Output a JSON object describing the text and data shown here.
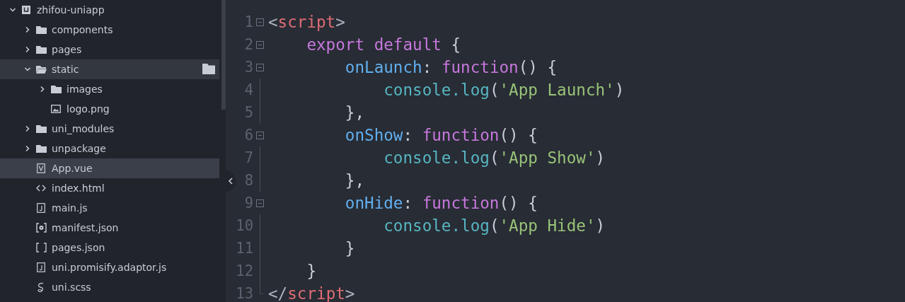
{
  "sidebar": {
    "tree": [
      {
        "label": "zhifou-uniapp",
        "kind": "project",
        "expanded": true,
        "selected": false,
        "hovered": false,
        "children": [
          {
            "label": "components",
            "kind": "folder",
            "expanded": false,
            "selected": false,
            "hovered": false
          },
          {
            "label": "pages",
            "kind": "folder",
            "expanded": false,
            "selected": false,
            "hovered": false
          },
          {
            "label": "static",
            "kind": "folder",
            "expanded": true,
            "selected": false,
            "hovered": true,
            "children": [
              {
                "label": "images",
                "kind": "folder",
                "expanded": false,
                "selected": false,
                "hovered": false
              },
              {
                "label": "logo.png",
                "kind": "image",
                "selected": false,
                "hovered": false
              }
            ]
          },
          {
            "label": "uni_modules",
            "kind": "folder",
            "expanded": false,
            "selected": false,
            "hovered": false
          },
          {
            "label": "unpackage",
            "kind": "folder",
            "expanded": false,
            "selected": false,
            "hovered": false
          },
          {
            "label": "App.vue",
            "kind": "vue",
            "selected": true,
            "hovered": false
          },
          {
            "label": "index.html",
            "kind": "html",
            "selected": false,
            "hovered": false
          },
          {
            "label": "main.js",
            "kind": "js",
            "selected": false,
            "hovered": false
          },
          {
            "label": "manifest.json",
            "kind": "config",
            "selected": false,
            "hovered": false
          },
          {
            "label": "pages.json",
            "kind": "json",
            "selected": false,
            "hovered": false
          },
          {
            "label": "uni.promisify.adaptor.js",
            "kind": "js",
            "selected": false,
            "hovered": false
          },
          {
            "label": "uni.scss",
            "kind": "sass",
            "selected": false,
            "hovered": false
          }
        ]
      }
    ]
  },
  "editor": {
    "lines": [
      {
        "number": "1",
        "fold": true,
        "tokens": [
          {
            "kind": "punct",
            "text": "<"
          },
          {
            "kind": "tag",
            "text": "script"
          },
          {
            "kind": "punct",
            "text": ">"
          }
        ]
      },
      {
        "number": "2",
        "fold": true,
        "tokens": [
          {
            "kind": "keyword",
            "text": "    export default"
          },
          {
            "kind": "plain",
            "text": " {"
          }
        ]
      },
      {
        "number": "3",
        "fold": true,
        "tokens": [
          {
            "kind": "prop",
            "text": "        onLaunch"
          },
          {
            "kind": "plain",
            "text": ": "
          },
          {
            "kind": "keyword",
            "text": "function"
          },
          {
            "kind": "plain",
            "text": "() {"
          }
        ]
      },
      {
        "number": "4",
        "fold": false,
        "tokens": [
          {
            "kind": "method",
            "text": "            console.log"
          },
          {
            "kind": "plain",
            "text": "("
          },
          {
            "kind": "string",
            "text": "'App Launch'"
          },
          {
            "kind": "plain",
            "text": ")"
          }
        ]
      },
      {
        "number": "5",
        "fold": false,
        "tokens": [
          {
            "kind": "plain",
            "text": "        },"
          }
        ]
      },
      {
        "number": "6",
        "fold": true,
        "tokens": [
          {
            "kind": "prop",
            "text": "        onShow"
          },
          {
            "kind": "plain",
            "text": ": "
          },
          {
            "kind": "keyword",
            "text": "function"
          },
          {
            "kind": "plain",
            "text": "() {"
          }
        ]
      },
      {
        "number": "7",
        "fold": false,
        "tokens": [
          {
            "kind": "method",
            "text": "            console.log"
          },
          {
            "kind": "plain",
            "text": "("
          },
          {
            "kind": "string",
            "text": "'App Show'"
          },
          {
            "kind": "plain",
            "text": ")"
          }
        ]
      },
      {
        "number": "8",
        "fold": false,
        "tokens": [
          {
            "kind": "plain",
            "text": "        },"
          }
        ]
      },
      {
        "number": "9",
        "fold": true,
        "tokens": [
          {
            "kind": "prop",
            "text": "        onHide"
          },
          {
            "kind": "plain",
            "text": ": "
          },
          {
            "kind": "keyword",
            "text": "function"
          },
          {
            "kind": "plain",
            "text": "() {"
          }
        ]
      },
      {
        "number": "10",
        "fold": false,
        "tokens": [
          {
            "kind": "method",
            "text": "            console.log"
          },
          {
            "kind": "plain",
            "text": "("
          },
          {
            "kind": "string",
            "text": "'App Hide'"
          },
          {
            "kind": "plain",
            "text": ")"
          }
        ]
      },
      {
        "number": "11",
        "fold": false,
        "tokens": [
          {
            "kind": "plain",
            "text": "        }"
          }
        ]
      },
      {
        "number": "12",
        "fold": false,
        "tokens": [
          {
            "kind": "plain",
            "text": "    }"
          }
        ]
      },
      {
        "number": "13",
        "fold": false,
        "tokens": [
          {
            "kind": "punct",
            "text": "</"
          },
          {
            "kind": "tag",
            "text": "script"
          },
          {
            "kind": "punct",
            "text": ">"
          }
        ]
      }
    ]
  }
}
